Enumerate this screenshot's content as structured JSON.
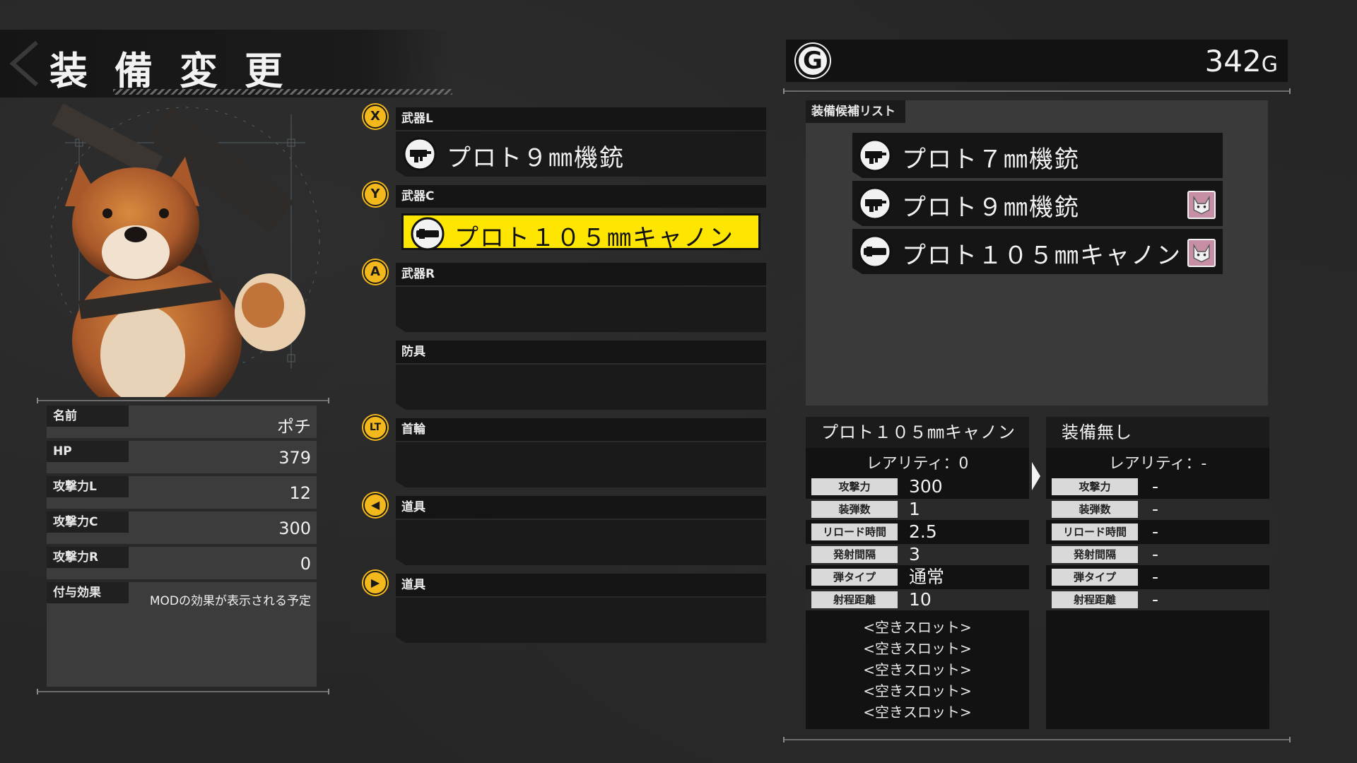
{
  "title": "装備変更",
  "gold": {
    "amount": "342",
    "unit": "G",
    "icon": "G"
  },
  "stats": [
    {
      "label": "名前",
      "value": "ポチ"
    },
    {
      "label": "HP",
      "value": "379"
    },
    {
      "label": "攻撃力L",
      "value": "12"
    },
    {
      "label": "攻撃力C",
      "value": "300"
    },
    {
      "label": "攻撃力R",
      "value": "0"
    },
    {
      "label": "付与効果",
      "value": "MODの効果が表示される予定"
    }
  ],
  "slots": [
    {
      "button": "X",
      "label": "武器L",
      "item": "プロト９㎜機銃",
      "item_icon": "machine-gun-icon"
    },
    {
      "button": "Y",
      "label": "武器C",
      "item": "プロト１０５㎜キャノン",
      "item_icon": "cannon-icon",
      "selected": true
    },
    {
      "button": "A",
      "label": "武器R",
      "item": ""
    },
    {
      "button": "",
      "label": "防具",
      "item": ""
    },
    {
      "button": "LT",
      "label": "首輪",
      "item": ""
    },
    {
      "button": "◀",
      "label": "道具",
      "item": ""
    },
    {
      "button": "▶",
      "label": "道具",
      "item": ""
    }
  ],
  "candidates": {
    "title": "装備候補リスト",
    "items": [
      {
        "name": "プロト７㎜機銃",
        "icon": "machine-gun-icon",
        "equipped_badge": false
      },
      {
        "name": "プロト９㎜機銃",
        "icon": "machine-gun-icon",
        "equipped_badge": true
      },
      {
        "name": "プロト１０５㎜キャノン",
        "icon": "cannon-icon",
        "equipped_badge": true
      }
    ]
  },
  "compare": {
    "left": {
      "name": "プロト１０５㎜キャノン",
      "rarity": "レアリティ：0",
      "rows": [
        {
          "label": "攻撃力",
          "value": "300"
        },
        {
          "label": "装弾数",
          "value": "1"
        },
        {
          "label": "リロード時間",
          "value": "2.5"
        },
        {
          "label": "発射間隔",
          "value": "3"
        },
        {
          "label": "弾タイプ",
          "value": "通常"
        },
        {
          "label": "射程距離",
          "value": "10"
        }
      ],
      "slots": [
        "<空きスロット>",
        "<空きスロット>",
        "<空きスロット>",
        "<空きスロット>",
        "<空きスロット>"
      ]
    },
    "right": {
      "name": "装備無し",
      "rarity": "レアリティ：-",
      "rows": [
        {
          "label": "攻撃力",
          "value": "-"
        },
        {
          "label": "装弾数",
          "value": "-"
        },
        {
          "label": "リロード時間",
          "value": "-"
        },
        {
          "label": "発射間隔",
          "value": "-"
        },
        {
          "label": "弾タイプ",
          "value": "-"
        },
        {
          "label": "射程距離",
          "value": "-"
        }
      ]
    }
  },
  "colors": {
    "accent_yellow": "#ffe600",
    "button_yellow": "#f3b81c",
    "badge_pink": "#c68fa6"
  }
}
